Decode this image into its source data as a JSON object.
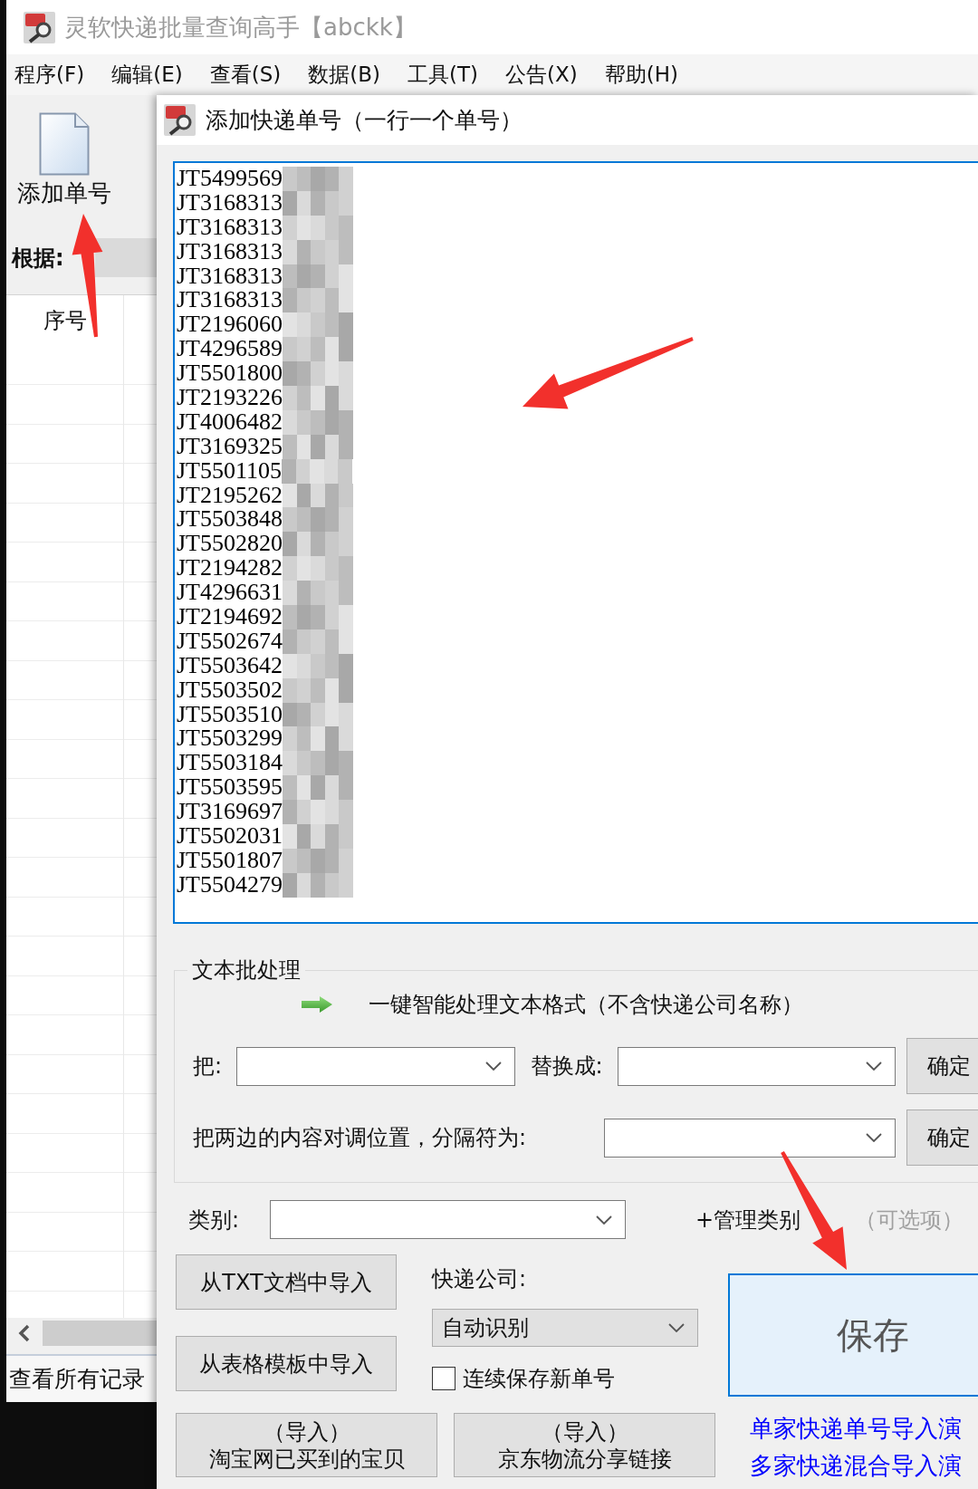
{
  "main_window": {
    "title": "灵软快递批量查询高手【abckk】",
    "menu": [
      "程序(F)",
      "编辑(E)",
      "查看(S)",
      "数据(B)",
      "工具(T)",
      "公告(X)",
      "帮助(H)"
    ],
    "toolbar": [
      {
        "label": "添加单号"
      }
    ],
    "filter_label": "根据:",
    "table": {
      "columns": [
        "序号"
      ]
    },
    "status_bar": "查看所有记录"
  },
  "dialog": {
    "title": "添加快递单号（一行一个单号）",
    "tracking_numbers": [
      "JT5499569",
      "JT3168313",
      "JT3168313",
      "JT3168313",
      "JT3168313",
      "JT3168313",
      "JT2196060",
      "JT4296589",
      "JT5501800",
      "JT2193226",
      "JT4006482",
      "JT3169325",
      "JT5501105",
      "JT2195262",
      "JT5503848",
      "JT5502820",
      "JT2194282",
      "JT4296631",
      "JT2194692",
      "JT5502674",
      "JT5503642",
      "JT5503502",
      "JT5503510",
      "JT5503299",
      "JT5503184",
      "JT5503595",
      "JT3169697",
      "JT5502031",
      "JT5501807",
      "JT5504279"
    ],
    "batch": {
      "title": "文本批处理",
      "smart_action": "一键智能处理文本格式（不含快递公司名称）",
      "rows": [
        {
          "fields": [
            "把:",
            "替换成:"
          ],
          "button": "确定"
        },
        {
          "fields": [
            "把两边的内容对调位置，分隔符为:"
          ],
          "button": "确定"
        }
      ]
    },
    "category": {
      "label": "类别:",
      "manage_link": "+管理类别",
      "hint": "（可选项）"
    },
    "import_buttons": [
      "从TXT文档中导入",
      "从表格模板中导入"
    ],
    "courier": {
      "label": "快递公司:",
      "value": "自动识别"
    },
    "continuous_save": {
      "label": "连续保存新单号",
      "checked": false
    },
    "save_button": "保存",
    "bottom_buttons": [
      {
        "caption": "（导入）",
        "label": "淘宝网已买到的宝贝"
      },
      {
        "caption": "（导入）",
        "label": "京东物流分享链接"
      }
    ],
    "demo_links": [
      "单家快递单号导入演",
      "多家快递混合导入演"
    ]
  }
}
